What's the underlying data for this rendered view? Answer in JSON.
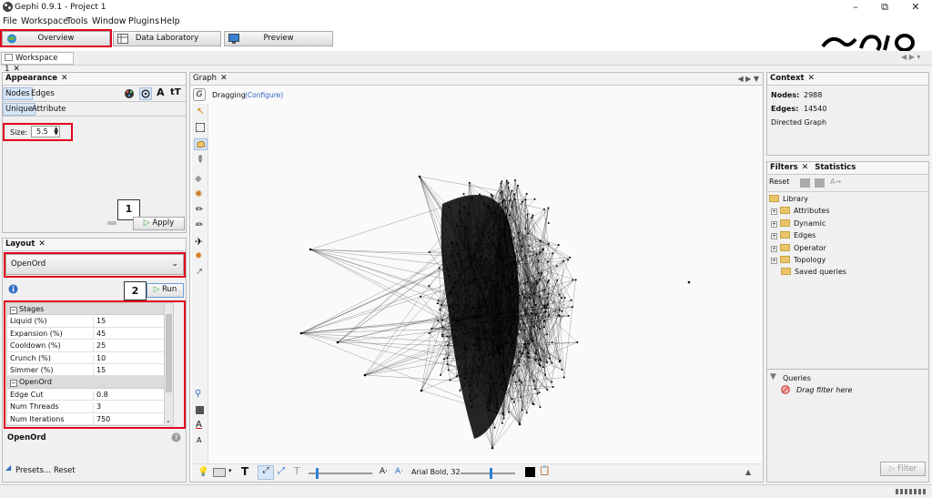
{
  "window": {
    "title": "Gephi 0.9.1 - Project 1"
  },
  "menu": [
    "File",
    "Workspace",
    "Tools",
    "Window",
    "Plugins",
    "Help"
  ],
  "main_tabs": {
    "overview": "Overview",
    "data_laboratory": "Data Laboratory",
    "preview": "Preview"
  },
  "workspace_tab": "Workspace 1",
  "appearance": {
    "title": "Appearance",
    "tabs": [
      "Nodes",
      "Edges"
    ],
    "subtabs": [
      "Unique",
      "Attribute"
    ],
    "size_label": "Size:",
    "size_value": "5.5",
    "apply_label": "Apply"
  },
  "annotations": {
    "one": "1",
    "two": "2"
  },
  "layout": {
    "title": "Layout",
    "algorithm": "OpenOrd",
    "run_label": "Run",
    "group_stages": "Stages",
    "stages": [
      {
        "key": "Liquid (%)",
        "value": "15"
      },
      {
        "key": "Expansion (%)",
        "value": "45"
      },
      {
        "key": "Cooldown (%)",
        "value": "25"
      },
      {
        "key": "Crunch (%)",
        "value": "10"
      },
      {
        "key": "Simmer (%)",
        "value": "15"
      }
    ],
    "group_openord": "OpenOrd",
    "openord": [
      {
        "key": "Edge Cut",
        "value": "0.8"
      },
      {
        "key": "Num Threads",
        "value": "3"
      },
      {
        "key": "Num Iterations",
        "value": "750"
      }
    ],
    "description_title": "OpenOrd",
    "presets_label": "Presets...",
    "reset_label": "Reset"
  },
  "graph": {
    "title": "Graph",
    "mode": "Dragging",
    "configure": "(Configure)",
    "font_label": "Arial Bold, 32"
  },
  "context": {
    "title": "Context",
    "nodes_label": "Nodes:",
    "nodes_value": "2988",
    "edges_label": "Edges:",
    "edges_value": "14540",
    "graph_type": "Directed Graph"
  },
  "filters": {
    "title": "Filters",
    "statistics_tab": "Statistics",
    "reset_label": "Reset",
    "library": "Library",
    "items": [
      "Attributes",
      "Dynamic",
      "Edges",
      "Operator",
      "Topology",
      "Saved queries"
    ],
    "queries": "Queries",
    "drag_hint": "Drag filter here",
    "filter_button": "Filter"
  },
  "colors": {
    "highlight_red": "#e3051b",
    "selected_tab": "#d7e6f7",
    "accent_blue": "#2f7fd8"
  }
}
